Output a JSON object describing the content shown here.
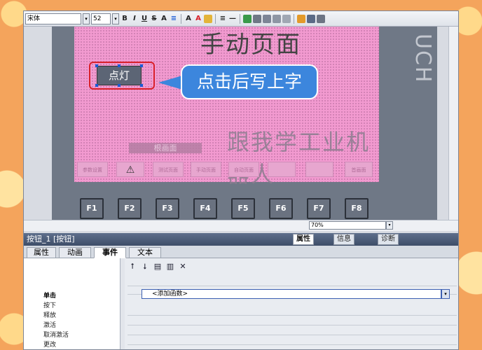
{
  "toolbar": {
    "font_name": "宋体",
    "font_size": "52",
    "buttons": [
      "B",
      "I",
      "U",
      "S",
      "A",
      "≡",
      "A",
      "A",
      "≡",
      "—"
    ]
  },
  "canvas": {
    "page_title": "手动页面",
    "light_button_label": "点灯",
    "callout_text": "点击后写上字",
    "watermark": "跟我学工业机器人",
    "side_text": "UCH",
    "back_button": "根画面",
    "nav_buttons": [
      "参数设置",
      "",
      "测试页面",
      "手动页面",
      "自动页面",
      "",
      "",
      "首画面"
    ],
    "fkeys": [
      "F1",
      "F2",
      "F3",
      "F4",
      "F5",
      "F6",
      "F7",
      "F8"
    ],
    "zoom": "70%"
  },
  "properties": {
    "header": "按钮_1 [按钮]",
    "right_tabs": [
      "属性",
      "信息",
      "诊断"
    ],
    "tabs": [
      "属性",
      "动画",
      "事件",
      "文本"
    ],
    "events": [
      "单击",
      "按下",
      "释放",
      "激活",
      "取消激活",
      "更改"
    ],
    "add_function": "<添加函数>"
  }
}
